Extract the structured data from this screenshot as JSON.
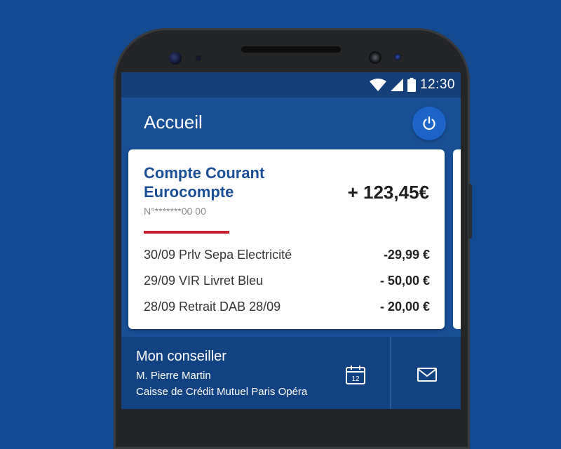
{
  "status_bar": {
    "time": "12:30",
    "icons": [
      "wifi-icon",
      "signal-icon",
      "battery-icon"
    ]
  },
  "header": {
    "title": "Accueil",
    "power_icon": "power-icon"
  },
  "account": {
    "name_line1": "Compte Courant",
    "name_line2": "Eurocompte",
    "number": "N°*******00 00",
    "balance": "+ 123,45€"
  },
  "transactions": [
    {
      "label": "30/09 Prlv Sepa Electricité",
      "amount": "-29,99 €"
    },
    {
      "label": "29/09 VIR Livret Bleu",
      "amount": "- 50,00 €"
    },
    {
      "label": "28/09 Retrait DAB 28/09",
      "amount": "- 20,00 €"
    }
  ],
  "advisor": {
    "title": "Mon conseiller",
    "name": "M. Pierre Martin",
    "branch": "Caisse de Crédit Mutuel Paris Opéra",
    "calendar_day": "12",
    "calendar_icon": "calendar-icon",
    "mail_icon": "mail-icon"
  },
  "colors": {
    "background": "#144a92",
    "accent_blue": "#1a4e96",
    "divider_red": "#c8202f",
    "power_button": "#1c64c8"
  }
}
